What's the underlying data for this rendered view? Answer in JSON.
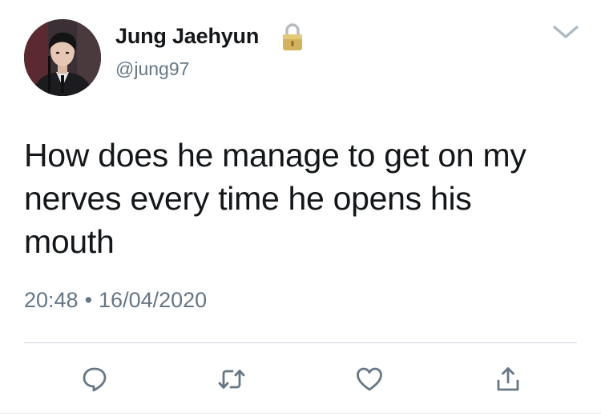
{
  "user": {
    "display_name": "Jung Jaehyun",
    "handle": "@jung97",
    "avatar": "profile-photo",
    "protected_icon": "lock-icon"
  },
  "tweet": {
    "text": "How does he manage to get on my nerves every time he opens his mouth",
    "time": "20:48",
    "separator": "•",
    "date": "16/04/2020"
  },
  "actions": [
    {
      "icon": "reply-icon"
    },
    {
      "icon": "retweet-icon"
    },
    {
      "icon": "like-icon"
    },
    {
      "icon": "share-icon"
    }
  ],
  "menu_icon": "chevron-down-icon",
  "colors": {
    "text": "#14171a",
    "secondary": "#657786",
    "divider": "#d0d6db",
    "lock": "#c9a84a"
  }
}
